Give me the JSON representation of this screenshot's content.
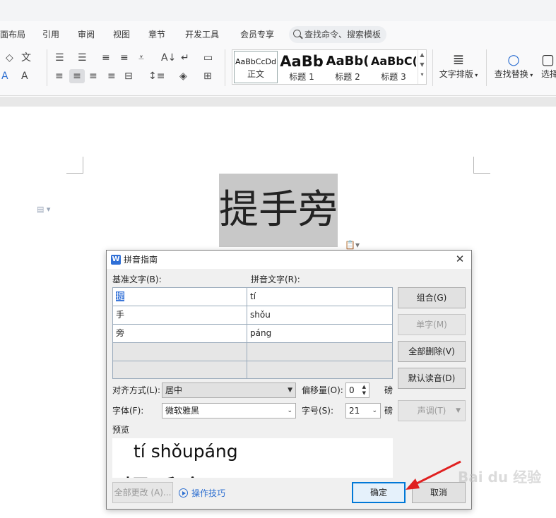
{
  "ribbon": {
    "tabs": [
      "面布局",
      "引用",
      "审阅",
      "视图",
      "章节",
      "开发工具",
      "会员专享"
    ],
    "search_placeholder": "查找命令、搜索模板",
    "styles": [
      {
        "preview": "AaBbCcDd",
        "name": "正文"
      },
      {
        "preview": "AaBb",
        "name": "标题 1"
      },
      {
        "preview": "AaBb(",
        "name": "标题 2"
      },
      {
        "preview": "AaBbC(",
        "name": "标题 3"
      }
    ],
    "text_layout_label": "文字排版",
    "find_replace_label": "查找替换",
    "select_label": "选择"
  },
  "document": {
    "selected_text": "提手旁"
  },
  "dialog": {
    "title": "拼音指南",
    "base_text_label": "基准文字(B):",
    "ruby_text_label": "拼音文字(R):",
    "rows": [
      {
        "base": "提",
        "ruby": "tí"
      },
      {
        "base": "手",
        "ruby": "shǒu"
      },
      {
        "base": "旁",
        "ruby": "páng"
      },
      {
        "base": "",
        "ruby": ""
      },
      {
        "base": "",
        "ruby": ""
      }
    ],
    "buttons": {
      "group": "组合(G)",
      "mono": "单字(M)",
      "clear_all": "全部删除(V)",
      "default_reading": "默认读音(D)",
      "tone": "声调(T)",
      "apply_all": "全部更改 (A)...",
      "ok": "确定",
      "cancel": "取消"
    },
    "alignment_label": "对齐方式(L):",
    "alignment_value": "居中",
    "offset_label": "偏移量(O):",
    "offset_value": "0",
    "offset_unit": "磅",
    "font_label": "字体(F):",
    "font_value": "微软雅黑",
    "size_label": "字号(S):",
    "size_value": "21",
    "size_unit": "磅",
    "preview_label": "预览",
    "preview_pinyin": "tí  shǒupáng",
    "preview_base": "提手旁",
    "tips_label": "操作技巧"
  },
  "colors": {
    "accent": "#0078d7",
    "link": "#2d6fd1",
    "arrow": "#e02020"
  }
}
